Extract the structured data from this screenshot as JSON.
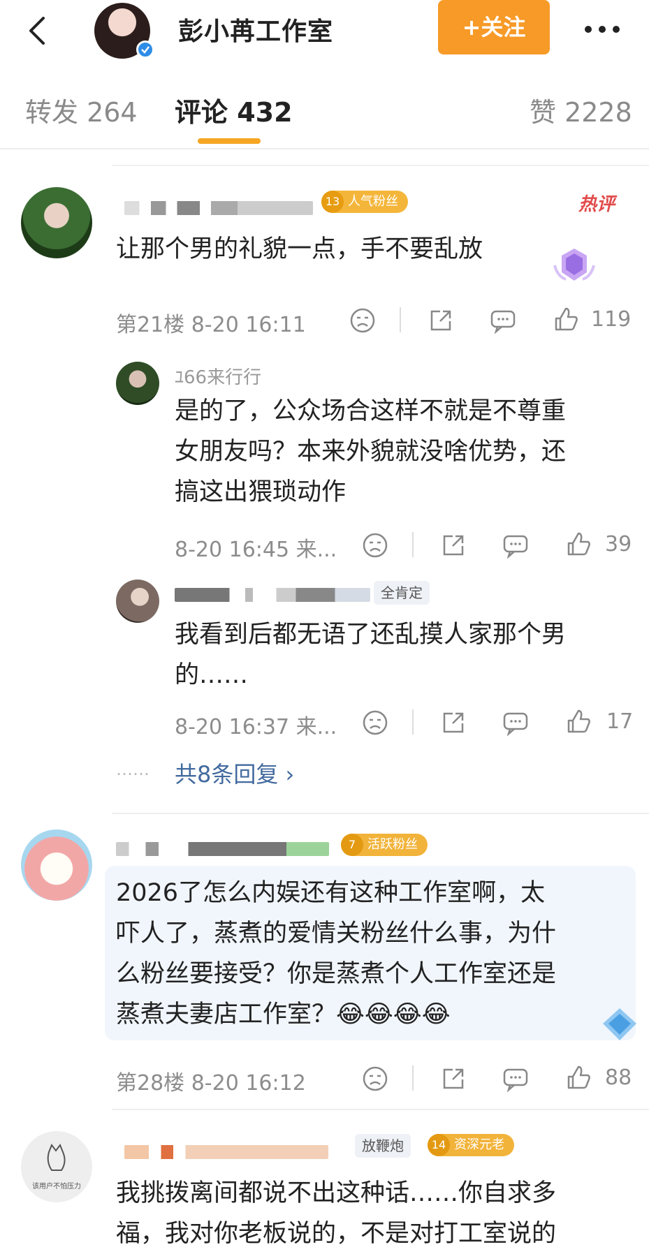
{
  "header": {
    "title": "彭小苒工作室",
    "follow_label": "+关注"
  },
  "tabs": {
    "repost": "转发 264",
    "comments": "评论 432",
    "likes": "赞 2228"
  },
  "comments": [
    {
      "badge_level": "13",
      "badge_text": "人气粉丝",
      "hot_label": "热评",
      "text": "让那个男的礼貌一点，手不要乱放",
      "floor_time": "第21楼 8-20 16:11",
      "likes": "119",
      "replies": [
        {
          "name_partial": "ﾕ66来行行",
          "text_lines": [
            "是的了，公众场合这样不就是不尊重",
            "女朋友吗？本来外貌就没啥优势，还",
            "搞这出猥琐动作"
          ],
          "time": "8-20 16:45 来...",
          "likes": "39"
        },
        {
          "badge_text": "全肯定",
          "text_lines": [
            "我看到后都无语了还乱摸人家那个男",
            "的……"
          ],
          "time": "8-20 16:37 来...",
          "likes": "17"
        }
      ],
      "more_replies": "共8条回复 ›",
      "dots": "……"
    },
    {
      "badge_level": "7",
      "badge_text": "活跃粉丝",
      "text_lines": [
        "2026了怎么内娱还有这种工作室啊，太",
        "吓人了，蒸煮的爱情关粉丝什么事，为什",
        "么粉丝要接受？你是蒸煮个人工作室还是",
        "蒸煮夫妻店工作室？😂😂😂😂"
      ],
      "floor_time": "第28楼 8-20 16:12",
      "likes": "88"
    },
    {
      "badge1_text": "放鞭炮",
      "badge_level": "14",
      "badge_text": "资深元老",
      "avatar_text": "该用户不怕压力",
      "text_lines": [
        "我挑拨离间都说不出这种话……你自求多",
        "福，我对你老板说的，不是对打工室说的"
      ]
    }
  ]
}
